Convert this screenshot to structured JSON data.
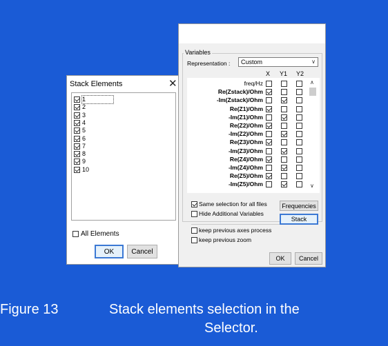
{
  "stack_dialog": {
    "title": "Stack Elements",
    "close_glyph": "✕",
    "elements": [
      {
        "label": "1",
        "checked": true
      },
      {
        "label": "2",
        "checked": true
      },
      {
        "label": "3",
        "checked": true
      },
      {
        "label": "4",
        "checked": true
      },
      {
        "label": "5",
        "checked": true
      },
      {
        "label": "6",
        "checked": true
      },
      {
        "label": "7",
        "checked": true
      },
      {
        "label": "8",
        "checked": true
      },
      {
        "label": "9",
        "checked": true
      },
      {
        "label": "10",
        "checked": true
      }
    ],
    "all_elements_label": "All Elements",
    "ok_label": "OK",
    "cancel_label": "Cancel"
  },
  "selector_dialog": {
    "variables_legend": "Variables",
    "representation_label": "Representation :",
    "representation_value": "Custom",
    "columns": [
      "X",
      "Y1",
      "Y2"
    ],
    "variables": [
      {
        "name": "freq/Hz",
        "x": false,
        "y1": false,
        "y2": false
      },
      {
        "name": "Re(Zstack)/Ohm",
        "x": true,
        "y1": false,
        "y2": false
      },
      {
        "name": "-Im(Zstack)/Ohm",
        "x": false,
        "y1": true,
        "y2": false
      },
      {
        "name": "Re(Z1)/Ohm",
        "x": true,
        "y1": false,
        "y2": false
      },
      {
        "name": "-Im(Z1)/Ohm",
        "x": false,
        "y1": true,
        "y2": false
      },
      {
        "name": "Re(Z2)/Ohm",
        "x": true,
        "y1": false,
        "y2": false
      },
      {
        "name": "-Im(Z2)/Ohm",
        "x": false,
        "y1": true,
        "y2": false
      },
      {
        "name": "Re(Z3)/Ohm",
        "x": true,
        "y1": false,
        "y2": false
      },
      {
        "name": "-Im(Z3)/Ohm",
        "x": false,
        "y1": true,
        "y2": false
      },
      {
        "name": "Re(Z4)/Ohm",
        "x": true,
        "y1": false,
        "y2": false
      },
      {
        "name": "-Im(Z4)/Ohm",
        "x": false,
        "y1": true,
        "y2": false
      },
      {
        "name": "Re(Z5)/Ohm",
        "x": true,
        "y1": false,
        "y2": false
      },
      {
        "name": "-Im(Z5)/Ohm",
        "x": false,
        "y1": true,
        "y2": false
      }
    ],
    "same_selection_label": "Same selection for all files",
    "same_selection_checked": true,
    "hide_additional_label": "Hide Additional Variables",
    "hide_additional_checked": false,
    "frequencies_label": "Frequencies",
    "stack_label": "Stack",
    "keep_axes_label": "keep previous axes process",
    "keep_zoom_label": "keep previous zoom",
    "ok_label": "OK",
    "cancel_label": "Cancel"
  },
  "caption": {
    "figure": "Figure 13",
    "text_line1": "Stack elements selection in the",
    "text_line2": "Selector."
  },
  "colors": {
    "background": "#1a5bd6",
    "dialog": "#f0f0f0",
    "accent": "#3a78d4"
  }
}
